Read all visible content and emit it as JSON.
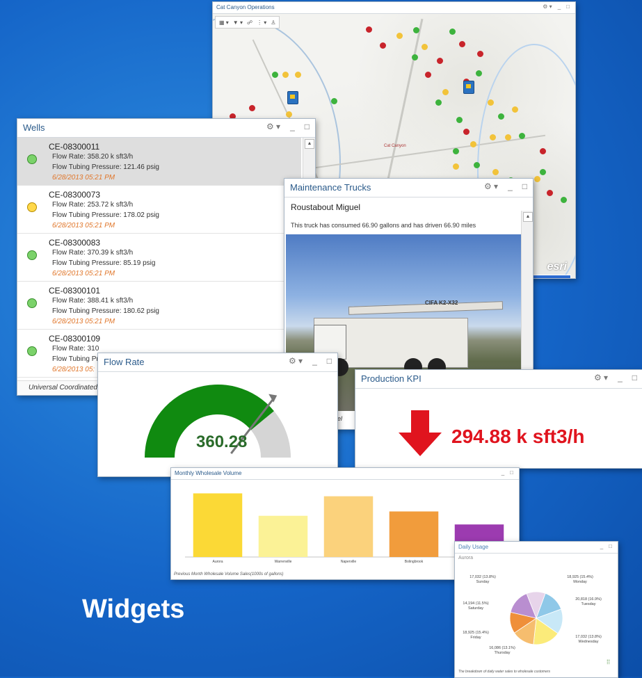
{
  "page": {
    "title": "Widgets"
  },
  "map_window": {
    "title": "Cat Canyon Operations",
    "toolbar": [
      "▦ ▾",
      "▼ ▾",
      "☍",
      "⋮ ▾",
      "♙"
    ],
    "place_label": "Cat Canyon",
    "logo": "esri",
    "controls": {
      "settings": "⚙ ▾",
      "min": "_",
      "max": "□"
    }
  },
  "wells": {
    "title": "Wells",
    "footer": "Universal Coordinated Time",
    "controls": {
      "settings": "⚙ ▾",
      "min": "_",
      "max": "□"
    },
    "items": [
      {
        "id": "CE-08300011",
        "flow": "Flow Rate: 358.20 k sft3/h",
        "pressure": "Flow Tubing Pressure: 121.46 psig",
        "date": "6/28/2013 05:21 PM",
        "status": "green"
      },
      {
        "id": "CE-08300073",
        "flow": "Flow Rate: 253.72 k sft3/h",
        "pressure": "Flow Tubing Pressure: 178.02 psig",
        "date": "6/28/2013 05:21 PM",
        "status": "yellow"
      },
      {
        "id": "CE-08300083",
        "flow": "Flow Rate: 370.39 k sft3/h",
        "pressure": "Flow Tubing Pressure: 85.19 psig",
        "date": "6/28/2013 05:21 PM",
        "status": "green"
      },
      {
        "id": "CE-08300101",
        "flow": "Flow Rate: 388.41 k sft3/h",
        "pressure": "Flow Tubing Pressure: 180.62 psig",
        "date": "6/28/2013 05:21 PM",
        "status": "green"
      },
      {
        "id": "CE-08300109",
        "flow": "Flow Rate: 310",
        "pressure": "Flow Tubing Pr",
        "date": "6/28/2013 05:",
        "status": "green"
      }
    ]
  },
  "trucks": {
    "title": "Maintenance Trucks",
    "name": "Roustabout Miguel",
    "description": "This truck has consumed 66.90 gallons and has driven 66.90 miles",
    "truck_text": "CIFA K2-X32",
    "caption_fragment": "el",
    "controls": {
      "settings": "⚙ ▾",
      "min": "_",
      "max": "□"
    }
  },
  "flow_rate": {
    "title": "Flow Rate",
    "value": "360.28",
    "gauge_fraction": 0.78,
    "controls": {
      "settings": "⚙ ▾",
      "min": "_",
      "max": "□"
    }
  },
  "kpi": {
    "title": "Production KPI",
    "value": "294.88 k sft3/h",
    "controls": {
      "settings": "⚙ ▾",
      "min": "_",
      "max": "□"
    }
  },
  "wholesale": {
    "title": "Monthly Wholesale Volume",
    "footnote": "Previous Month Wholesale Volume Sales(1000s of gallons)",
    "controls": {
      "min": "_",
      "max": "□"
    }
  },
  "daily": {
    "title": "Daily Usage",
    "subtitle": "Aurora",
    "footnote": "The breakdown of daily water sales to wholesale customers",
    "controls": {
      "min": "_",
      "max": "□"
    },
    "slice_labels": [
      {
        "value": "17,032 (13.8%)",
        "day": "Sunday"
      },
      {
        "value": "18,925 (15.4%)",
        "day": "Monday"
      },
      {
        "value": "20,818 (16.9%)",
        "day": "Tuesday"
      },
      {
        "value": "17,032 (13.8%)",
        "day": "Wednesday"
      },
      {
        "value": "16,086 (13.1%)",
        "day": "Thursday"
      },
      {
        "value": "18,925 (15.4%)",
        "day": "Friday"
      },
      {
        "value": "14,194 (11.5%)",
        "day": "Saturday"
      }
    ]
  },
  "colors": {
    "bg": "#1565c8",
    "gauge_fill": "#108a10",
    "kpi_red": "#e0141e",
    "bar1": "#fbd936",
    "bar2": "#fbf296",
    "bar3": "#fbd27c",
    "bar4": "#f19c3c",
    "bar5": "#9c3bb0"
  },
  "chart_data": [
    {
      "type": "bar",
      "title": "Monthly Wholesale Volume",
      "categories": [
        "Aurora",
        "Warrenville",
        "Naperville",
        "Bolingbrook",
        ""
      ],
      "values": [
        88,
        57,
        84,
        63,
        45
      ],
      "ylim": [
        0,
        100
      ],
      "colors": [
        "#fbd936",
        "#fbf296",
        "#fbd27c",
        "#f19c3c",
        "#9c3bb0"
      ],
      "xlabel": "",
      "ylabel": ""
    },
    {
      "type": "pie",
      "title": "Daily Usage",
      "categories": [
        "Sunday",
        "Monday",
        "Tuesday",
        "Wednesday",
        "Thursday",
        "Friday",
        "Saturday"
      ],
      "values": [
        17032,
        18925,
        20818,
        17032,
        16086,
        18925,
        14194
      ],
      "colors": [
        "#8fc8e8",
        "#c8e8f7",
        "#fbeb7a",
        "#f6bd6e",
        "#ef8f3a",
        "#b98ed0",
        "#e7d4ea"
      ]
    }
  ]
}
